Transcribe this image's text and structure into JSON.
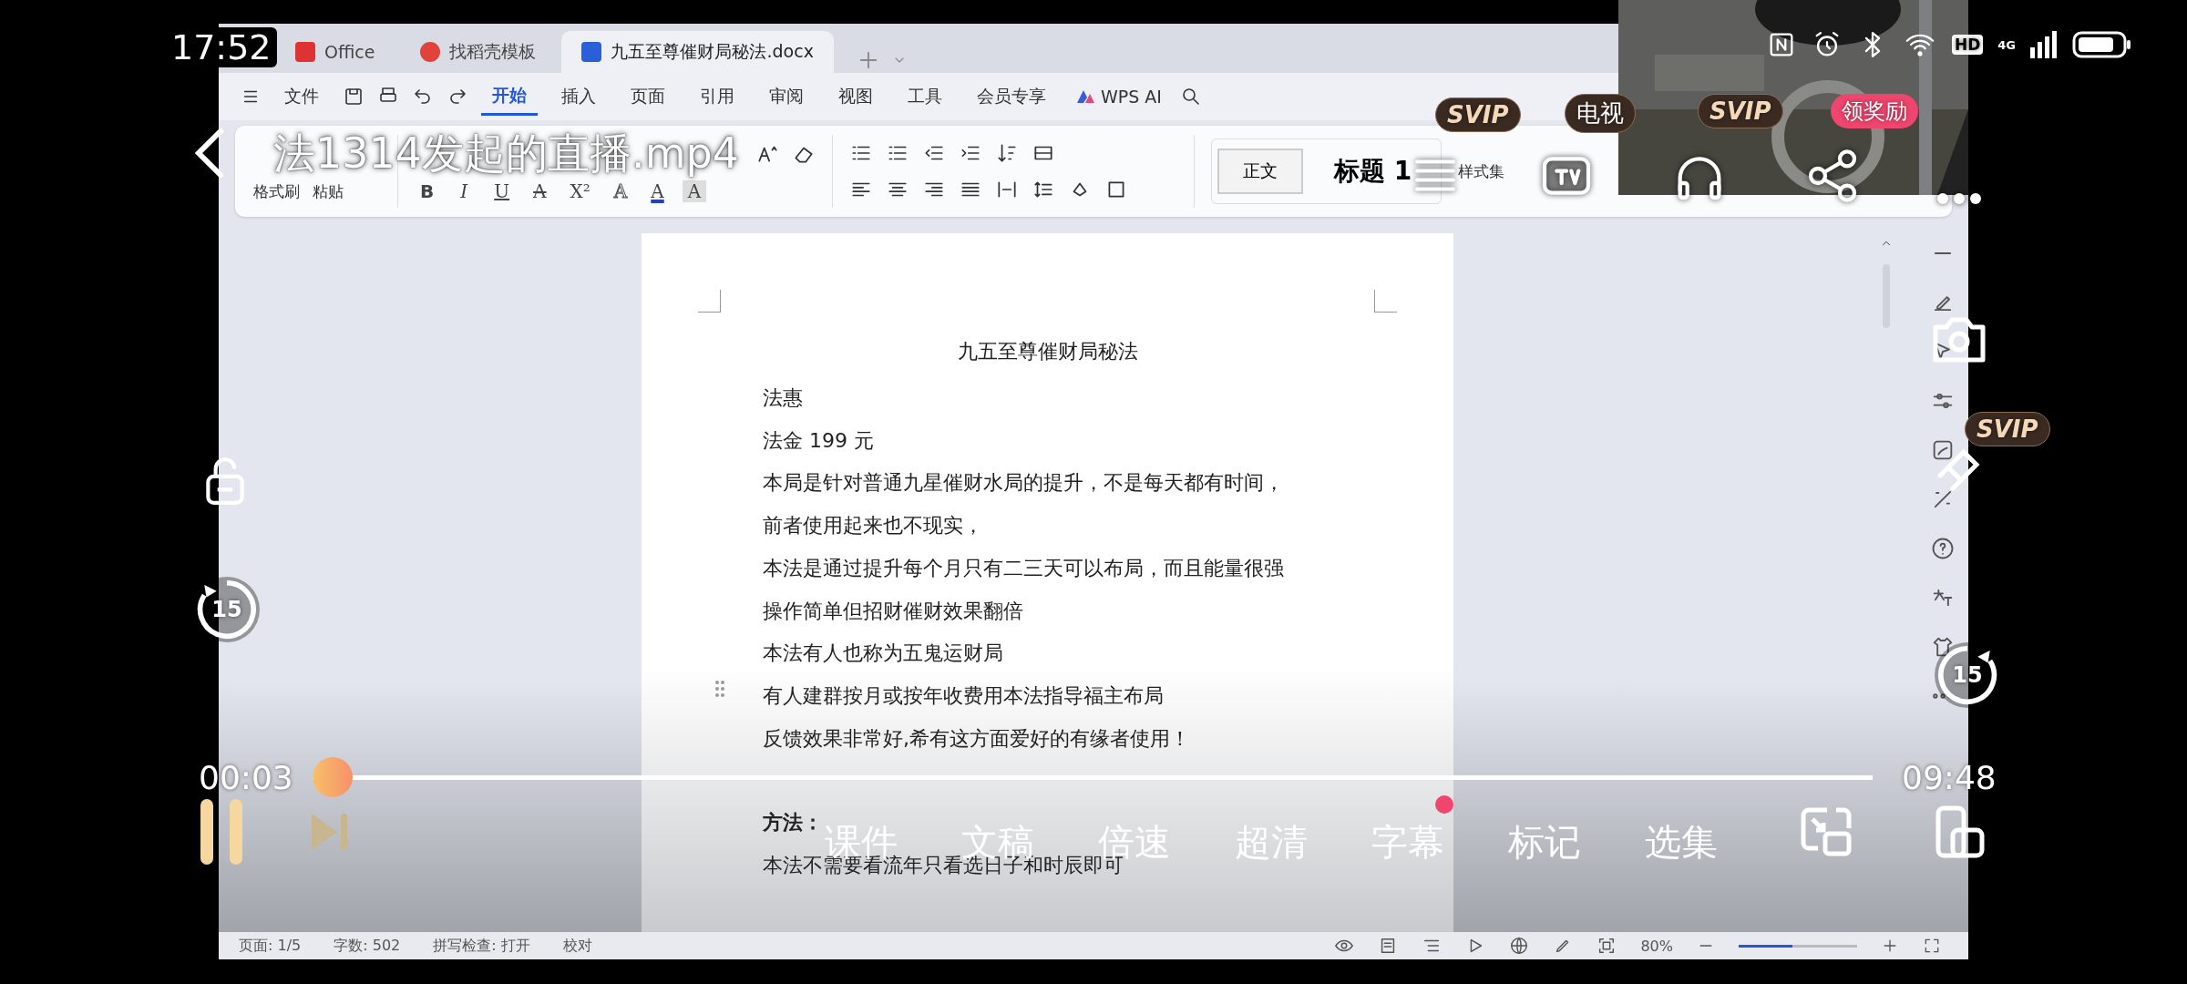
{
  "phone_status": {
    "time": "17:52",
    "network": "4G",
    "hd": "HD"
  },
  "wps": {
    "tabs": [
      {
        "label": "Office",
        "selected": false,
        "kind": "home"
      },
      {
        "label": "找稻壳模板",
        "selected": false,
        "kind": "template"
      },
      {
        "label": "九五至尊催财局秘法.docx",
        "selected": true,
        "kind": "doc"
      }
    ],
    "menu": {
      "file": "文件",
      "ai": "WPS AI",
      "tabs": [
        {
          "label": "开始",
          "selected": true
        },
        {
          "label": "插入",
          "selected": false
        },
        {
          "label": "页面",
          "selected": false
        },
        {
          "label": "引用",
          "selected": false
        },
        {
          "label": "审阅",
          "selected": false
        },
        {
          "label": "视图",
          "selected": false
        },
        {
          "label": "工具",
          "selected": false
        },
        {
          "label": "会员专享",
          "selected": false
        }
      ]
    },
    "ribbon": {
      "format_painter": "格式刷",
      "paste": "粘贴",
      "font_buttons": [
        {
          "label": "B",
          "kind": "bold"
        },
        {
          "label": "I",
          "kind": "italic"
        },
        {
          "label": "U",
          "kind": "underline"
        },
        {
          "label": "A",
          "kind": "strike"
        },
        {
          "label": "X²",
          "kind": "plain"
        },
        {
          "label": "A",
          "kind": "outline"
        },
        {
          "label": "A",
          "kind": "color"
        },
        {
          "label": "A",
          "kind": "shade"
        }
      ],
      "styles": [
        {
          "label": "正文",
          "selected": true
        },
        {
          "label": "标题 1",
          "selected": false
        }
      ],
      "style_set": "样式集"
    },
    "document": {
      "title": "九五至尊催财局秘法",
      "paragraphs": [
        {
          "text": "法惠",
          "bold": false,
          "space_before": false
        },
        {
          "text": "法金 199 元",
          "bold": false,
          "space_before": false
        },
        {
          "text": "本局是针对普通九星催财水局的提升，不是每天都有时间，",
          "bold": false,
          "space_before": false
        },
        {
          "text": "前者使用起来也不现实，",
          "bold": false,
          "space_before": false
        },
        {
          "text": "本法是通过提升每个月只有二三天可以布局，而且能量很强",
          "bold": false,
          "space_before": false
        },
        {
          "text": "操作简单但招财催财效果翻倍",
          "bold": false,
          "space_before": false
        },
        {
          "text": "本法有人也称为五鬼运财局",
          "bold": false,
          "space_before": false
        },
        {
          "text": "有人建群按月或按年收费用本法指导福主布局",
          "bold": false,
          "space_before": false
        },
        {
          "text": "反馈效果非常好,希有这方面爱好的有缘者使用！",
          "bold": false,
          "space_before": false
        },
        {
          "text": "方法：",
          "bold": true,
          "space_before": true
        },
        {
          "text": "本法不需要看流年只看选日子和时辰即可",
          "bold": false,
          "space_before": false
        }
      ]
    },
    "status": {
      "page": "页面: 1/5",
      "words": "字数: 502",
      "spell": "拼写检查: 打开",
      "proof": "校对",
      "zoom": "80%",
      "zoom_slider": {
        "level": 0.45
      }
    }
  },
  "player": {
    "title": "法1314发起的直播.mp4",
    "top_actions": [
      {
        "kind": "lines",
        "badge": "SVIP"
      },
      {
        "kind": "tv",
        "badge": "电视"
      },
      {
        "kind": "headphones",
        "badge": "SVIP"
      },
      {
        "kind": "share",
        "badge": "领奖励"
      },
      {
        "kind": "more"
      }
    ],
    "rewind": "15",
    "forward": "15",
    "side_badge": "SVIP",
    "elapsed": "00:03",
    "duration": "09:48",
    "progress": {
      "level": 0.0
    },
    "controls": [
      {
        "label": "课件",
        "dot": false
      },
      {
        "label": "文稿",
        "dot": false
      },
      {
        "label": "倍速",
        "dot": false
      },
      {
        "label": "超清",
        "dot": false
      },
      {
        "label": "字幕",
        "dot": true
      },
      {
        "label": "标记",
        "dot": false
      },
      {
        "label": "选集",
        "dot": false
      }
    ]
  }
}
